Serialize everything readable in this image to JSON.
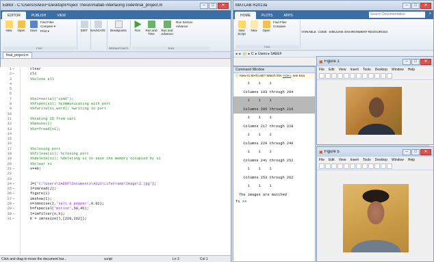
{
  "editor": {
    "title": "Editor - C:\\Users\\SAEEF\\Desktop\\Project Thesis\\matlab interfacing code\\final_project.m",
    "tabs": [
      "EDITOR",
      "PUBLISH",
      "VIEW"
    ],
    "buttons": {
      "new": "New",
      "open": "Open",
      "save": "Save",
      "find_files": "Find Files",
      "compare": "Compare ▾",
      "print": "Print ▾",
      "edit": "EDIT",
      "navigate": "NAVIGATE",
      "breakpoints": "Breakpoints",
      "run": "Run",
      "run_and_time": "Run and Time",
      "run_and_advance": "Run and Advance",
      "run_section": "Run Section",
      "advance": "Advance"
    },
    "group_labels": {
      "file": "FILE",
      "breakpoints": "BREAKPOINTS",
      "run": "RUN"
    },
    "file_tab": "final_project.m",
    "lines": [
      {
        "n": "1",
        "d": "−",
        "t": "clear",
        "c": "code"
      },
      {
        "n": "2",
        "d": "−",
        "t": "clc",
        "c": "code"
      },
      {
        "n": "3",
        "d": "",
        "t": "%%close all",
        "c": "cmt"
      },
      {
        "n": "4",
        "d": "",
        "t": "",
        "c": "code"
      },
      {
        "n": "5",
        "d": "",
        "t": "",
        "c": "code"
      },
      {
        "n": "6",
        "d": "",
        "t": "",
        "c": "code"
      },
      {
        "n": "7",
        "d": "",
        "t": "%%s1=serial('com5');",
        "c": "cmt"
      },
      {
        "n": "8",
        "d": "",
        "t": "%%fopen(s1); %communicating with port",
        "c": "cmt"
      },
      {
        "n": "9",
        "d": "",
        "t": "%%fwrite(s1,word); %writing to port",
        "c": "cmt"
      },
      {
        "n": "10",
        "d": "",
        "t": "",
        "c": "code"
      },
      {
        "n": "11",
        "d": "",
        "t": "%%taking ID from uart",
        "c": "cmt"
      },
      {
        "n": "12",
        "d": "",
        "t": "%%pause(2)",
        "c": "cmt"
      },
      {
        "n": "13",
        "d": "",
        "t": "%%x=fread(s1);",
        "c": "cmt"
      },
      {
        "n": "14",
        "d": "",
        "t": "",
        "c": "code"
      },
      {
        "n": "15",
        "d": "",
        "t": "",
        "c": "code"
      },
      {
        "n": "16",
        "d": "",
        "t": "",
        "c": "code"
      },
      {
        "n": "17",
        "d": "",
        "t": "%%closing port",
        "c": "cmt"
      },
      {
        "n": "18",
        "d": "",
        "t": "%%fclose(s1); %closing port",
        "c": "cmt"
      },
      {
        "n": "19",
        "d": "",
        "t": "%%delete(s1); %deleting s1 to save the memory occupied by s1",
        "c": "cmt"
      },
      {
        "n": "20",
        "d": "",
        "t": "%%clear s1",
        "c": "cmt"
      },
      {
        "n": "21",
        "d": "−",
        "t": "x=49;",
        "c": "code"
      },
      {
        "n": "22",
        "d": "",
        "t": "",
        "c": "code"
      },
      {
        "n": "23",
        "d": "",
        "t": "",
        "c": "code"
      },
      {
        "n": "24",
        "d": "−",
        "t": "J=('C:\\Users\\SAEEF\\Documents\\ASUS\\LifeFrame\\Image\\2.jpg');",
        "c": "code"
      },
      {
        "n": "25",
        "d": "−",
        "t": "I=imread(J);",
        "c": "code"
      },
      {
        "n": "26",
        "d": "−",
        "t": "figure(1)",
        "c": "code"
      },
      {
        "n": "27",
        "d": "−",
        "t": "imshow(I);",
        "c": "code"
      },
      {
        "n": "28",
        "d": "−",
        "t": "n=imnoise(I,'salt & pepper',0.02);",
        "c": "code"
      },
      {
        "n": "29",
        "d": "−",
        "t": "h=fspecial('motion',50,45);",
        "c": "code"
      },
      {
        "n": "30",
        "d": "−",
        "t": "l=imfilter(n,h);",
        "c": "code"
      },
      {
        "n": "31",
        "d": "−",
        "t": "K = imresize(l,[220,262]);",
        "c": "code"
      }
    ],
    "status": {
      "message": "Click and drag to move the document bar...",
      "mode": "script",
      "ln": "Ln  3",
      "col": "Col  1"
    }
  },
  "matlab": {
    "title": "MATLAB R2013a",
    "tabs": [
      "HOME",
      "PLOTS",
      "APPS"
    ],
    "search_placeholder": "Search Documentation",
    "buttons": {
      "new_script": "New Script",
      "new": "New",
      "open": "Open",
      "find_files": "Find Files",
      "compare": "Compare",
      "variable": "VARIABLE",
      "code": "CODE",
      "simulink": "SIMULINK",
      "environment": "ENVIRONMENT",
      "resources": "RESOURCES"
    },
    "group_file": "FILE",
    "path": "▸ C: ▸ Users ▸ SAEEF",
    "cmd_title": "Command Window",
    "cmd_info": "New to MATLAB? Watch this ",
    "cmd_info_link": "Video",
    "cmd_info_rest": ", see Exa",
    "cmd_lines": [
      {
        "t": "    1    1    1",
        "hl": false
      },
      {
        "t": "  Columns 193 through 204",
        "hl": false
      },
      {
        "t": "    1    1    1",
        "hl": true
      },
      {
        "t": "  Columns 205 through 216",
        "hl": true
      },
      {
        "t": "    1    1    1",
        "hl": false
      },
      {
        "t": "  Columns 217 through 228",
        "hl": false
      },
      {
        "t": "    1    1    1",
        "hl": false
      },
      {
        "t": "  Columns 229 through 240",
        "hl": false
      },
      {
        "t": "    1    1    1",
        "hl": false
      },
      {
        "t": "  Columns 241 through 252",
        "hl": false
      },
      {
        "t": "    1    1    1",
        "hl": false
      },
      {
        "t": "  Columns 253 through 262",
        "hl": false
      },
      {
        "t": "    1    1    1",
        "hl": false
      },
      {
        "t": "The images are matched",
        "hl": false
      }
    ],
    "prompt": "fx >>"
  },
  "figure1": {
    "title": "Figure 1",
    "menu": [
      "File",
      "Edit",
      "View",
      "Insert",
      "Tools",
      "Desktop",
      "Window",
      "Help"
    ]
  },
  "figure5": {
    "title": "Figure 5",
    "menu": [
      "File",
      "Edit",
      "View",
      "Insert",
      "Tools",
      "Desktop",
      "Window",
      "Help"
    ]
  },
  "colors": {
    "ribbon_blue": "#3b6ea5",
    "comment": "#228b22",
    "string": "#a020f0",
    "highlight": "#b8b8b8"
  }
}
